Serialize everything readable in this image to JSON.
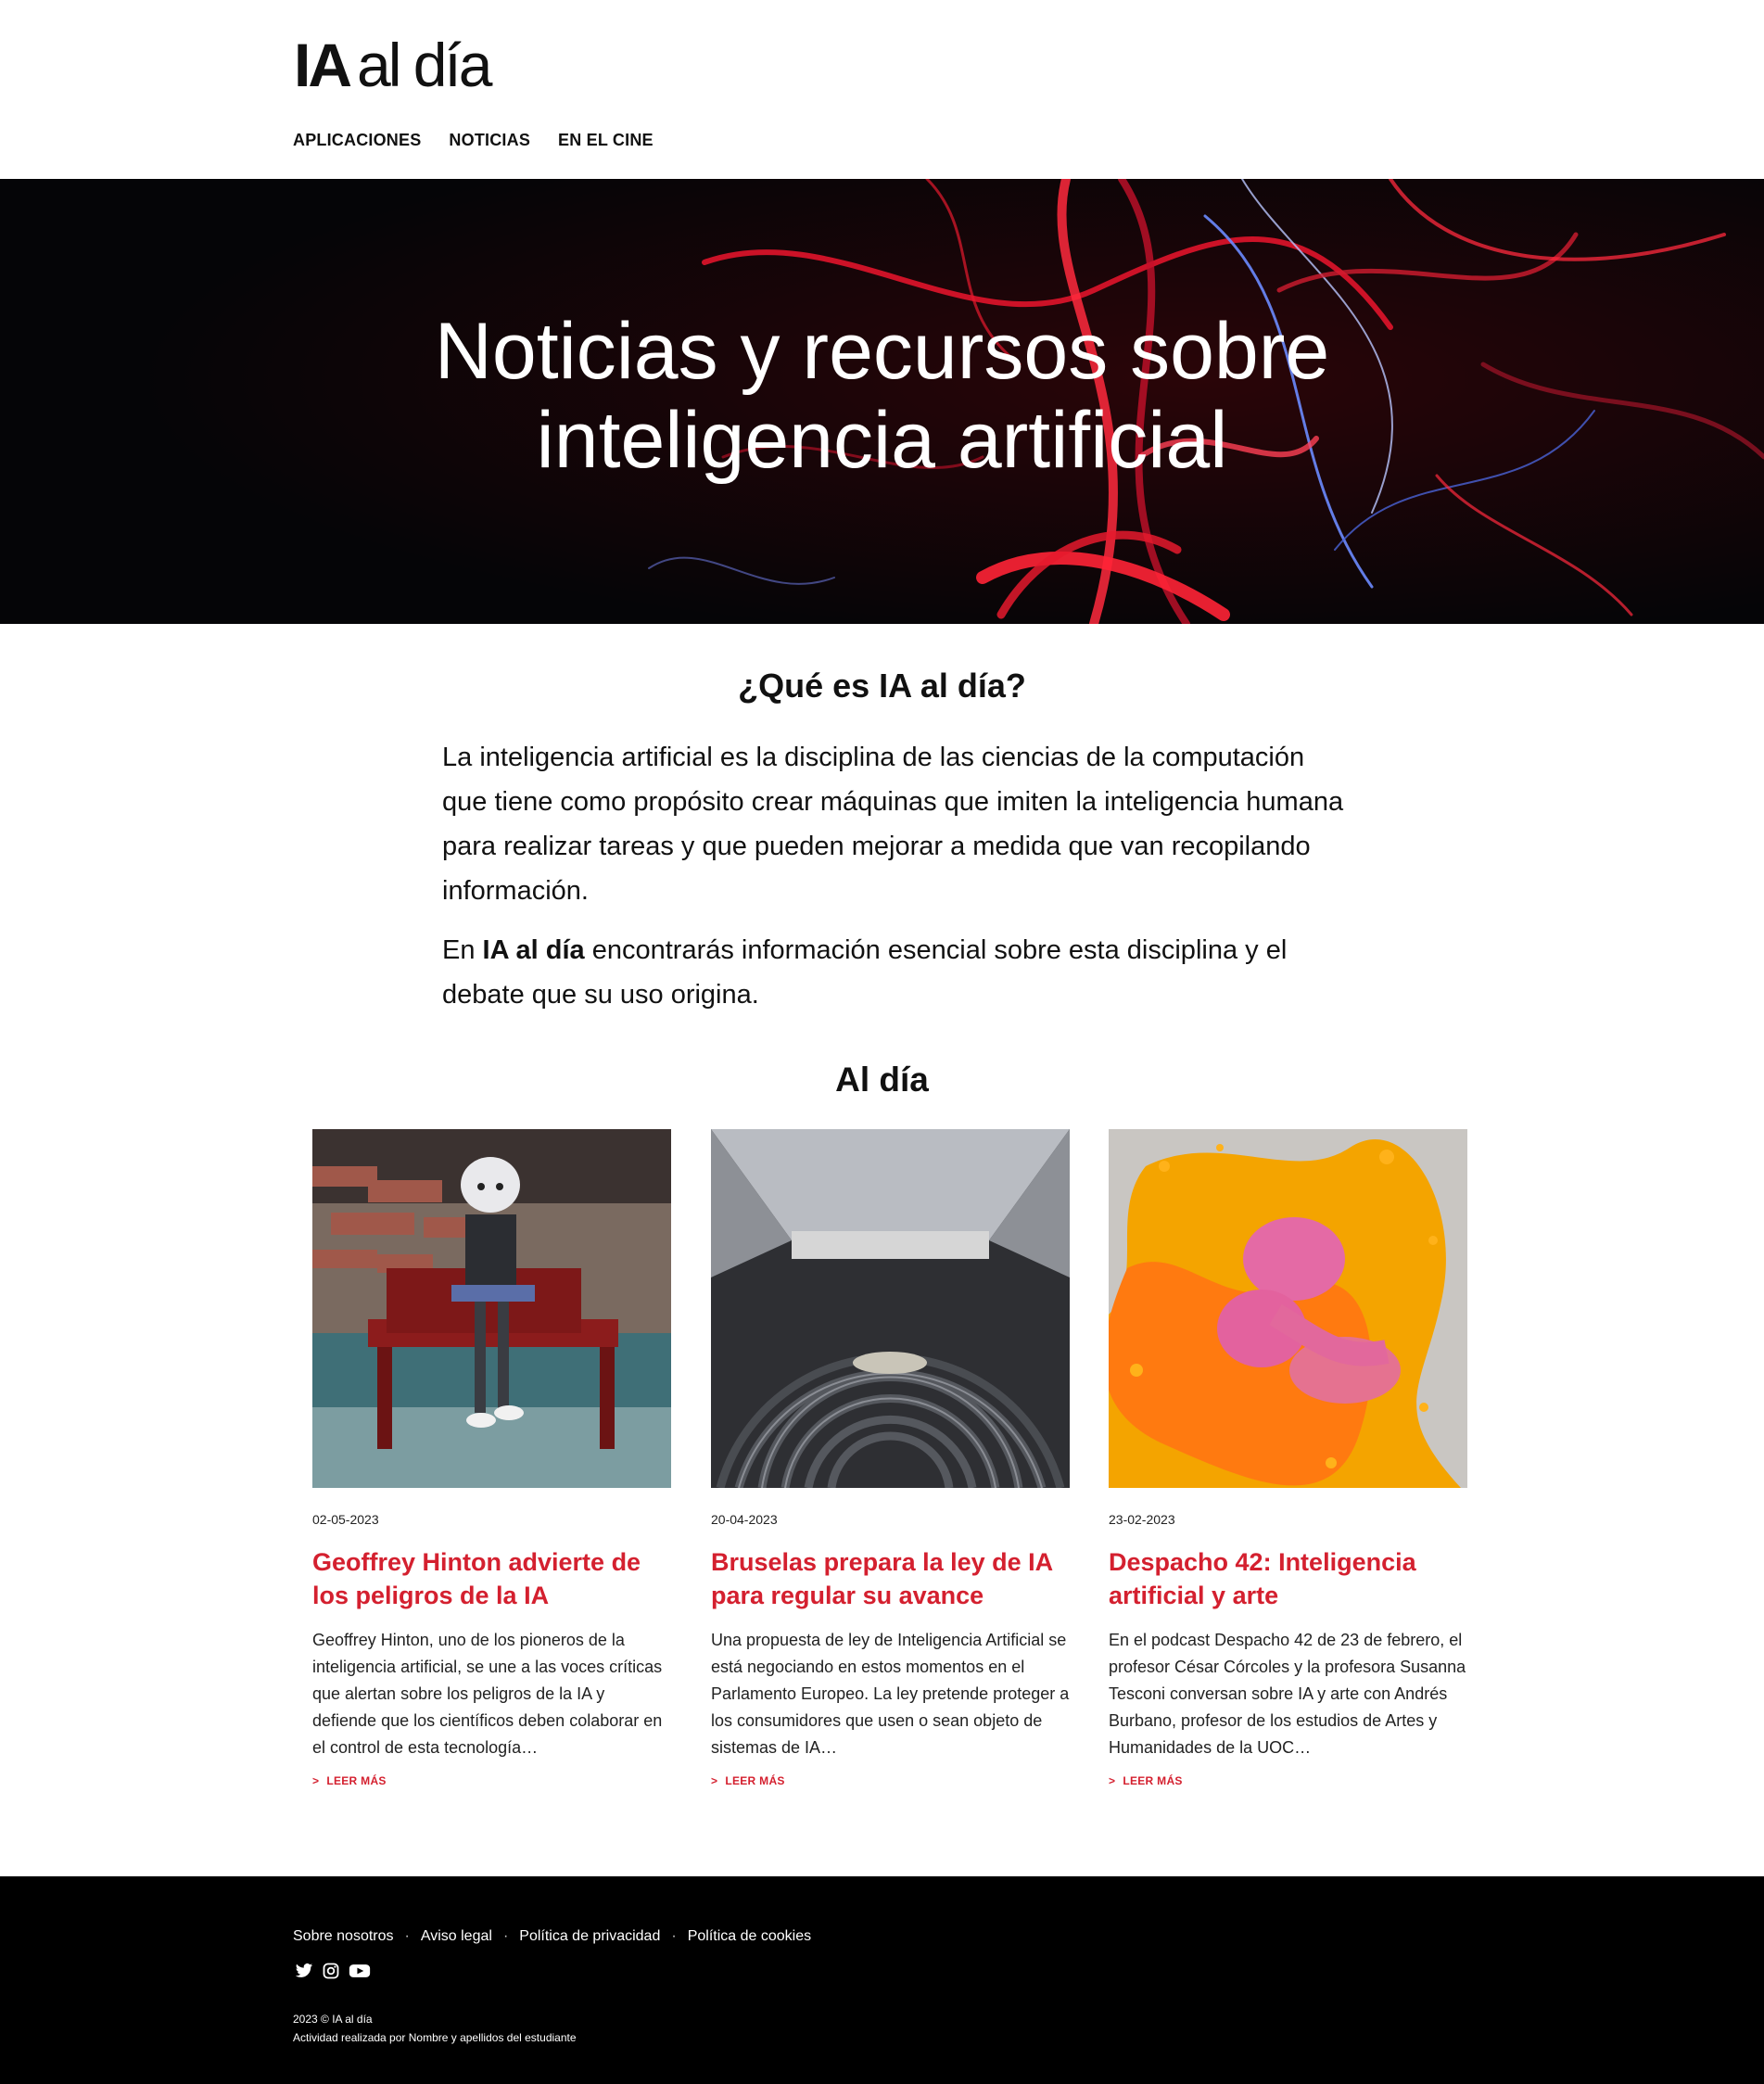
{
  "header": {
    "logo_bold": "IA",
    "logo_light": "al día",
    "nav": [
      "APLICACIONES",
      "NOTICIAS",
      "EN EL CINE"
    ]
  },
  "hero": {
    "title_line1": "Noticias y recursos sobre",
    "title_line2": "inteligencia artificial"
  },
  "about": {
    "title": "¿Qué es IA al día?",
    "p1": "La inteligencia artificial es la disciplina de las ciencias de la computación que tiene como propósito crear máquinas que imiten la inteligencia humana para realizar tareas y que pueden mejorar a medida que van recopilando información.",
    "p2_before": "En ",
    "p2_bold": "IA al día",
    "p2_after": " encontrarás información esencial sobre esta disciplina y el debate que su uso origina."
  },
  "news": {
    "title": "Al día",
    "cards": [
      {
        "date": "02-05-2023",
        "title": "Geoffrey Hinton advierte de los peligros de la IA",
        "excerpt": "Geoffrey Hinton, uno de los pioneros de la inteligencia artificial, se une a las voces críticas que alertan sobre los peligros de la IA y defiende que los científicos deben colaborar en el control de esta tecnología…",
        "more": "LEER MÁS"
      },
      {
        "date": "20-04-2023",
        "title": "Bruselas prepara la ley de IA para regular su avance",
        "excerpt": "Una propuesta de ley de Inteligencia Artificial se está negociando en estos momentos en el Parlamento Europeo. La ley pretende proteger a los consumidores que usen o sean objeto de sistemas de IA…",
        "more": "LEER MÁS"
      },
      {
        "date": "23-02-2023",
        "title": "Despacho 42: Inteligencia artificial y arte",
        "excerpt": "En el podcast Despacho 42 de 23 de febrero, el profesor César Córcoles y la profesora Susanna Tesconi conversan sobre IA y arte con Andrés Burbano, profesor de los estudios de Artes y Humanidades de la UOC…",
        "more": "LEER MÁS"
      }
    ]
  },
  "footer": {
    "links": [
      "Sobre nosotros",
      "Aviso legal",
      "Política de privacidad",
      "Política de cookies"
    ],
    "social": [
      "twitter-icon",
      "instagram-icon",
      "youtube-icon"
    ],
    "copyright": "2023 © IA al día",
    "credit": "Actividad realizada por Nombre y apellidos del estudiante"
  },
  "colors": {
    "accent": "#d4202f",
    "footer_bg": "#000000",
    "hero_bg": "#050507"
  }
}
